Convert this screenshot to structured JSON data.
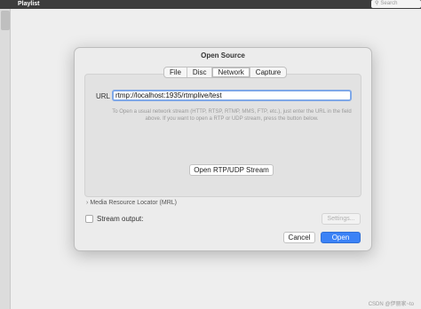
{
  "topbar": {
    "title": "Playlist",
    "search_placeholder": "Search"
  },
  "dialog": {
    "title": "Open Source",
    "tabs": [
      {
        "label": "File"
      },
      {
        "label": "Disc"
      },
      {
        "label": "Network",
        "active": true
      },
      {
        "label": "Capture"
      }
    ],
    "url_label": "URL",
    "url_value": "rtmp://localhost:1935/rtmplive/test",
    "hint": "To Open a usual network stream (HTTP, RTSP, RTMP, MMS, FTP, etc.), just enter the URL in the field above. If you want to open a RTP or UDP stream, press the button below.",
    "rtp_button": "Open RTP/UDP Stream",
    "mrl_label": "Media Resource Locator (MRL)",
    "stream_output_label": "Stream output:",
    "stream_output_checked": false,
    "settings_button": "Settings...",
    "cancel_button": "Cancel",
    "open_button": "Open"
  },
  "watermark": "CSDN @伊丽家~to",
  "colors": {
    "primary_button": "#3b82f6",
    "titlebar": "#3d3d3d"
  }
}
